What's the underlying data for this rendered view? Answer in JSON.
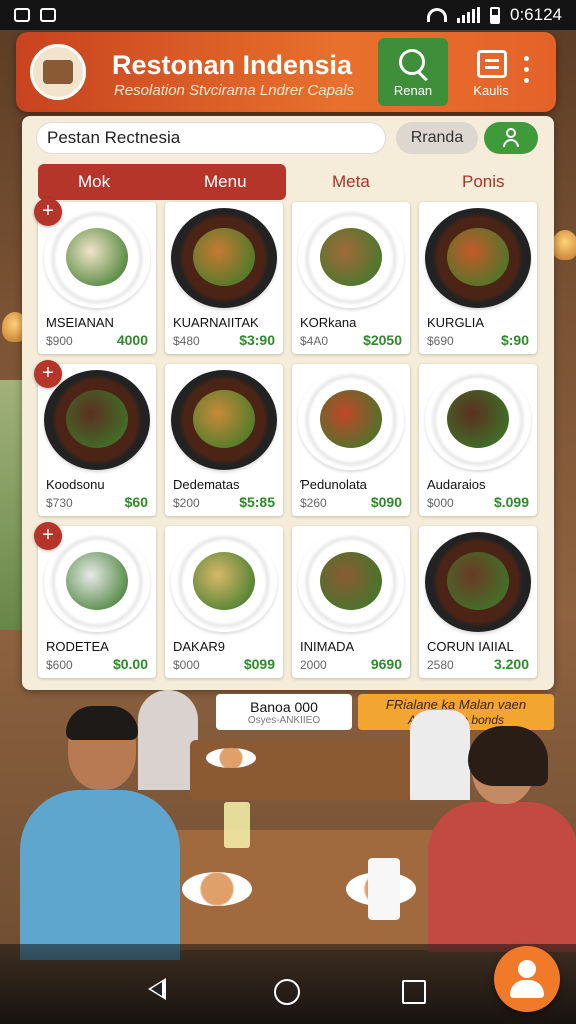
{
  "status_bar": {
    "time": "0:6124"
  },
  "header": {
    "title": "Restonan Indensia",
    "subtitle": "Resolation Stvcirama Lndrer Capals",
    "btn_search_label": "Renan",
    "btn_list_label": "Kaulis",
    "accent": "#d8522a"
  },
  "search": {
    "value": "Pestan Rectnesia",
    "secondary_pill": "Rranda"
  },
  "tabs": [
    {
      "label": "Mok"
    },
    {
      "label": "Menu"
    },
    {
      "label": "Meta"
    },
    {
      "label": "Ponis"
    }
  ],
  "dishes": [
    {
      "name": "MSEIANAN",
      "old": "$900",
      "price": "4000",
      "food_color": "#f1e4c8",
      "dark": false
    },
    {
      "name": "KUARNAIITAK",
      "old": "$480",
      "price": "$3:90",
      "food_color": "#c77a32",
      "dark": true
    },
    {
      "name": "KORkana",
      "old": "$4A0",
      "price": "$2050",
      "food_color": "#a26a3a",
      "dark": false
    },
    {
      "name": "KURGLIA",
      "old": "$690",
      "price": "$:90",
      "food_color": "#c55a2a",
      "dark": true
    },
    {
      "name": "Koodsonu",
      "old": "$730",
      "price": "$60",
      "food_color": "#5b2f20",
      "dark": true
    },
    {
      "name": "Dedematas",
      "old": "$200",
      "price": "$5:85",
      "food_color": "#c98a38",
      "dark": true
    },
    {
      "name": "Ƥedunolata",
      "old": "$260",
      "price": "$090",
      "food_color": "#c2462a",
      "dark": false
    },
    {
      "name": "Audaraios",
      "old": "$000",
      "price": "$.099",
      "food_color": "#5a3020",
      "dark": false
    },
    {
      "name": "RODETEA",
      "old": "$600",
      "price": "$0.00",
      "food_color": "#e9e9e9",
      "dark": false
    },
    {
      "name": "DAKAR9",
      "old": "$000",
      "price": "$099",
      "food_color": "#d8b86a",
      "dark": false
    },
    {
      "name": "INIMADA",
      "old": "2000",
      "price": "9690",
      "food_color": "#8a5a34",
      "dark": false
    },
    {
      "name": "CORUN IAIIAL",
      "old": "2580",
      "price": "3.200",
      "food_color": "#6a3a24",
      "dark": true
    }
  ],
  "promo": {
    "left_title": "Banoa 000",
    "left_sub": "Osyes-ANKIIEO",
    "right_line1": "FRialane ka Malan vaen",
    "right_line2": "AlkesSolen bonds"
  },
  "colors": {
    "primary_red": "#b5352b",
    "green": "#3f9a3a",
    "price_green": "#2e8a2a",
    "fab": "#f07a2a"
  },
  "icons": [
    "search-icon",
    "list-icon",
    "more-icon",
    "user-icon",
    "plus-icon",
    "back-icon",
    "home-icon",
    "recent-apps-icon"
  ]
}
